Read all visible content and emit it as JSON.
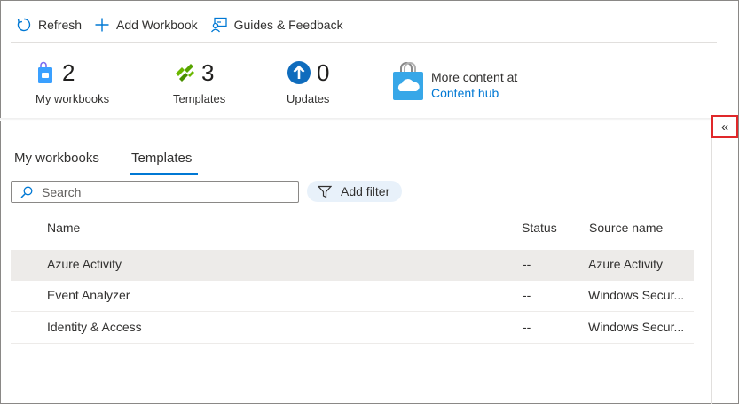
{
  "toolbar": {
    "refresh_label": "Refresh",
    "add_workbook_label": "Add Workbook",
    "guides_label": "Guides & Feedback"
  },
  "stats": {
    "my_workbooks": {
      "count": "2",
      "label": "My workbooks",
      "icon": "workbook-bag-icon"
    },
    "templates": {
      "count": "3",
      "label": "Templates",
      "icon": "templates-icon"
    },
    "updates": {
      "count": "0",
      "label": "Updates",
      "icon": "update-arrow-icon"
    }
  },
  "content_hub": {
    "text": "More content at",
    "link": "Content hub",
    "icon": "content-hub-bag-icon"
  },
  "tabs": [
    {
      "label": "My workbooks",
      "active": false
    },
    {
      "label": "Templates",
      "active": true
    }
  ],
  "search": {
    "placeholder": "Search",
    "value": ""
  },
  "filter": {
    "label": "Add filter"
  },
  "table": {
    "columns": [
      "Name",
      "Status",
      "Source name"
    ],
    "rows": [
      {
        "name": "Azure Activity",
        "status": "--",
        "source": "Azure Activity",
        "selected": true
      },
      {
        "name": "Event Analyzer",
        "status": "--",
        "source": "Windows Secur...",
        "selected": false
      },
      {
        "name": "Identity & Access",
        "status": "--",
        "source": "Windows Secur...",
        "selected": false
      }
    ]
  },
  "collapse": {
    "glyph": "«"
  },
  "colors": {
    "accent": "#0078d4",
    "highlight_border": "#e0282a",
    "selected_row": "#edebe9",
    "filter_pill": "#e8f1fa"
  }
}
